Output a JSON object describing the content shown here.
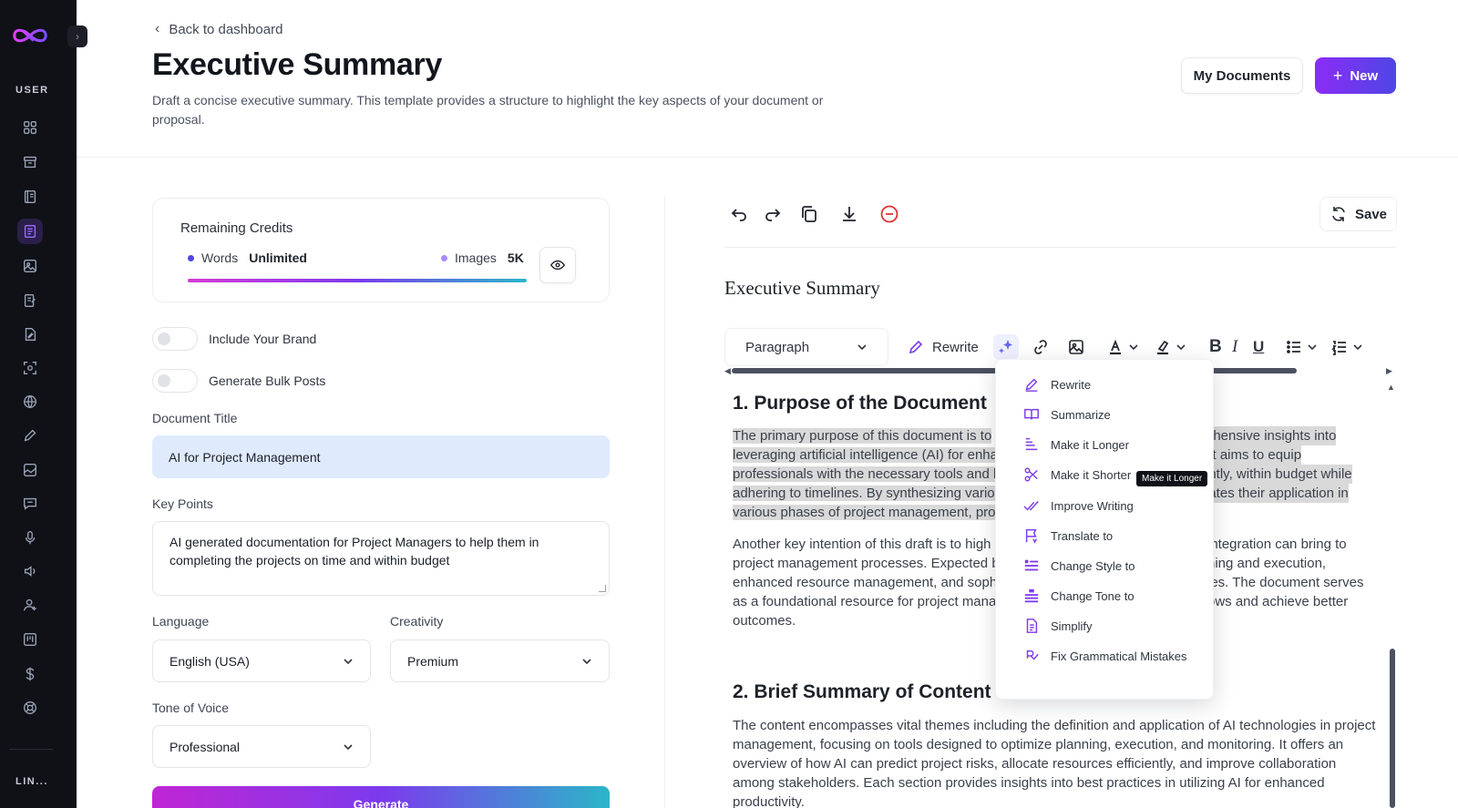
{
  "sidebar": {
    "section_user": "USER",
    "section_links": "LIN...",
    "icons": [
      "dashboard-icon",
      "archive-icon",
      "book-icon",
      "document-icon",
      "image-icon",
      "document-edit-icon",
      "file-edit-icon",
      "scan-icon",
      "web-icon",
      "pen-icon",
      "image-alt-icon",
      "chat-icon",
      "microphone-icon",
      "speaker-icon",
      "user-add-icon",
      "kanban-icon",
      "dollar-icon",
      "support-icon"
    ],
    "active_index": 3
  },
  "header": {
    "back_label": "Back to dashboard",
    "title": "Executive Summary",
    "description": "Draft a concise executive summary. This template provides a structure to highlight the key aspects of your document or proposal.",
    "my_documents_label": "My Documents",
    "new_label": "New"
  },
  "credits": {
    "title": "Remaining Credits",
    "words_label": "Words",
    "words_value": "Unlimited",
    "images_label": "Images",
    "images_value": "5K",
    "words_color": "#4f46e5",
    "images_color": "#a78bfa"
  },
  "form": {
    "include_brand_label": "Include Your Brand",
    "bulk_posts_label": "Generate Bulk Posts",
    "document_title_label": "Document Title",
    "document_title_value": "AI for Project Management",
    "key_points_label": "Key Points",
    "key_points_value": "AI generated documentation for Project Managers to help them in completing the projects on time and within budget",
    "language_label": "Language",
    "language_value": "English (USA)",
    "creativity_label": "Creativity",
    "creativity_value": "Premium",
    "tone_label": "Tone of Voice",
    "tone_value": "Professional",
    "generate_label": "Generate"
  },
  "editor": {
    "save_label": "Save",
    "doc_title": "Executive Summary",
    "paragraph_select": "Paragraph",
    "rewrite_label": "Rewrite",
    "section1_heading": "1. Purpose of the Document",
    "section1_lines": [
      {
        "left": "The primary purpose of this document is to ",
        "right": "rehensive insights into"
      },
      {
        "left": "leveraging artificial intelligence (AI) for enha",
        "right": ". It aims to equip"
      },
      {
        "left": "professionals with the necessary tools and k",
        "right": "ently, within budget while"
      },
      {
        "left": "adhering to timelines. By synthesizing variou",
        "right": "eates their application in"
      },
      {
        "left": "various phases of project management, pro",
        "right": ""
      }
    ],
    "section1_para2_lines": [
      {
        "left": "Another key intention of this draft is to high",
        "right": "integration can bring to"
      },
      {
        "left": "project management processes. Expected be",
        "right": "ning and execution,"
      },
      {
        "left": "enhanced resource management, and sophi",
        "right": "ies. The document serves"
      },
      {
        "left": "as a foundational resource for project mana",
        "right": "ows and achieve better"
      },
      {
        "left": "outcomes.",
        "right": ""
      }
    ],
    "section2_heading": "2. Brief Summary of Content",
    "section2_text": "The content encompasses vital themes including the definition and application of AI technologies in project management, focusing on tools designed to optimize planning, execution, and monitoring. It offers an overview of how AI can predict project risks, allocate resources efficiently, and improve collaboration among stakeholders. Each section provides insights into best practices in utilizing AI for enhanced productivity."
  },
  "ai_menu": {
    "items": [
      "Rewrite",
      "Summarize",
      "Make it Longer",
      "Make it Shorter",
      "Improve Writing",
      "Translate to",
      "Change Style to",
      "Change Tone to",
      "Simplify",
      "Fix Grammatical Mistakes"
    ],
    "tooltip": "Make it Longer",
    "accent_color": "#7c3aed"
  }
}
